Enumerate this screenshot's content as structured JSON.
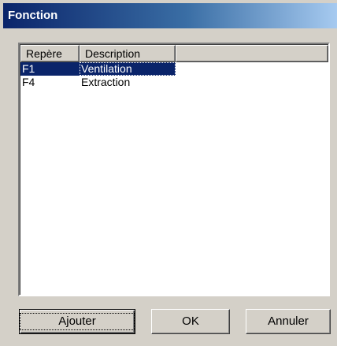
{
  "window": {
    "title": "Fonction"
  },
  "list": {
    "columns": [
      "Repère",
      "Description",
      ""
    ],
    "rows": [
      {
        "code": "F1",
        "description": "Ventilation",
        "selected": true
      },
      {
        "code": "F4",
        "description": "Extraction",
        "selected": false
      }
    ]
  },
  "buttons": {
    "add_label": "Ajouter",
    "ok_label": "OK",
    "cancel_label": "Annuler"
  },
  "colors": {
    "title_start": "#0a246a",
    "title_end": "#a6caf0",
    "selection": "#0a246a",
    "face": "#d4d0c8"
  }
}
